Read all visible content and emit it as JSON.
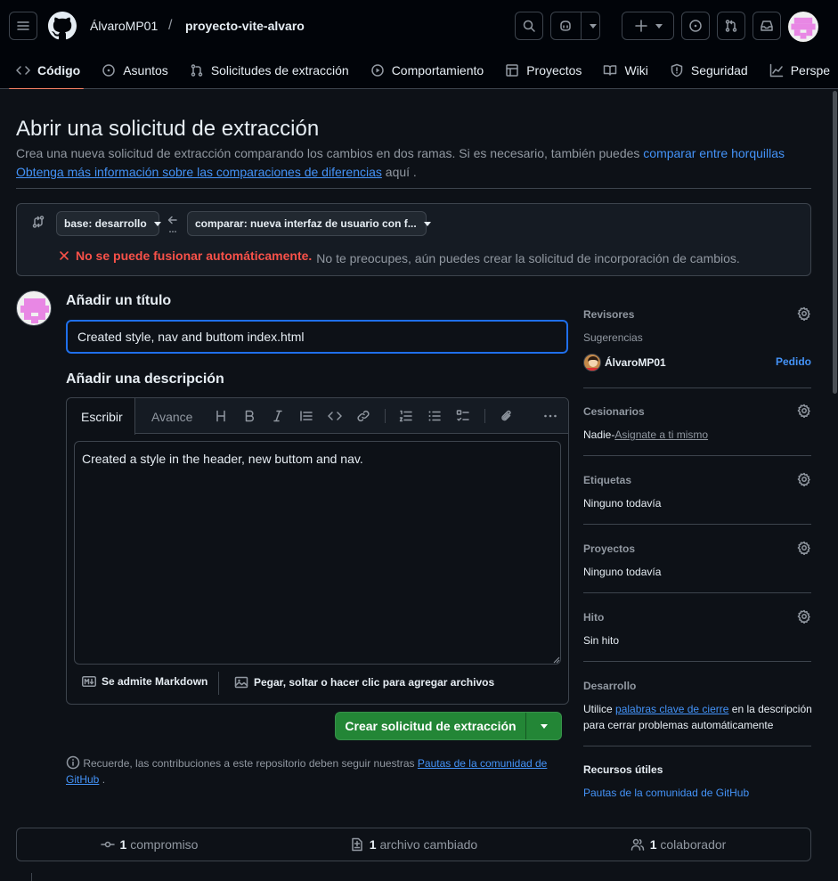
{
  "header": {
    "owner": "ÁlvaroMP01",
    "separator": "/",
    "repo": "proyecto-vite-alvaro"
  },
  "tabs": [
    {
      "label": "Código",
      "icon": "code-icon"
    },
    {
      "label": "Asuntos",
      "icon": "issue-icon"
    },
    {
      "label": "Solicitudes de extracción",
      "icon": "pull-request-icon"
    },
    {
      "label": "Comportamiento",
      "icon": "play-icon"
    },
    {
      "label": "Proyectos",
      "icon": "table-icon"
    },
    {
      "label": "Wiki",
      "icon": "book-icon"
    },
    {
      "label": "Seguridad",
      "icon": "shield-icon"
    },
    {
      "label": "Perspe",
      "icon": "graph-icon"
    }
  ],
  "page": {
    "title": "Abrir una solicitud de extracción",
    "subtitle": "Crea una nueva solicitud de extracción comparando los cambios en dos ramas. Si es necesario, también puedes",
    "compare_forks_link": "comparar entre horquillas",
    "learn_more_link": "Obtenga más información sobre las comparaciones de diferencias",
    "learn_more_suffix": "aquí ."
  },
  "compare": {
    "base": "base: desarrollo",
    "compare": "comparar: nueva interfaz de usuario con f...",
    "status_error": "No se puede fusionar automáticamente.",
    "status_note": "No te preocupes, aún puedes crear la solicitud de incorporación de cambios."
  },
  "form": {
    "title_label": "Añadir un título",
    "title_value": "Created style, nav and buttom index.html",
    "description_label": "Añadir una descripción",
    "tab_write": "Escribir",
    "tab_preview": "Avance",
    "description_value": "Created a style in the header, new buttom and nav.",
    "markdown_note": "Se admite Markdown",
    "attach_note": "Pegar, soltar o hacer clic para agregar archivos",
    "create_button": "Crear solicitud de extracción",
    "guidelines_prefix": "Recuerde, las contribuciones a este repositorio deben seguir nuestras",
    "guidelines_link": "Pautas de la comunidad de GitHub",
    "guidelines_suffix": "."
  },
  "sidebar": {
    "reviewers": {
      "title": "Revisores",
      "suggestions": "Sugerencias",
      "user": "ÁlvaroMP01",
      "request": "Pedido"
    },
    "assignees": {
      "title": "Cesionarios",
      "none": "Nadie-",
      "assign_self": "Asignate a ti mismo"
    },
    "labels": {
      "title": "Etiquetas",
      "value": "Ninguno todavía"
    },
    "projects": {
      "title": "Proyectos",
      "value": "Ninguno todavía"
    },
    "milestone": {
      "title": "Hito",
      "value": "Sin hito"
    },
    "development": {
      "title": "Desarrollo",
      "prefix": "Utilice",
      "link": "palabras clave de cierre",
      "suffix": "en la descripción para cerrar problemas automáticamente"
    },
    "resources": {
      "title": "Recursos útiles",
      "link": "Pautas de la comunidad de GitHub"
    }
  },
  "summary": {
    "commits_count": "1",
    "commits_label": "compromiso",
    "files_count": "1",
    "files_label": "archivo cambiado",
    "contributors_count": "1",
    "contributors_label": "colaborador"
  },
  "colors": {
    "background": "#0d1117",
    "accent_link": "#4493f8",
    "primary_button": "#238636",
    "error": "#f85149",
    "tab_underline": "#f78166",
    "avatar_pink": "#e887e4"
  }
}
